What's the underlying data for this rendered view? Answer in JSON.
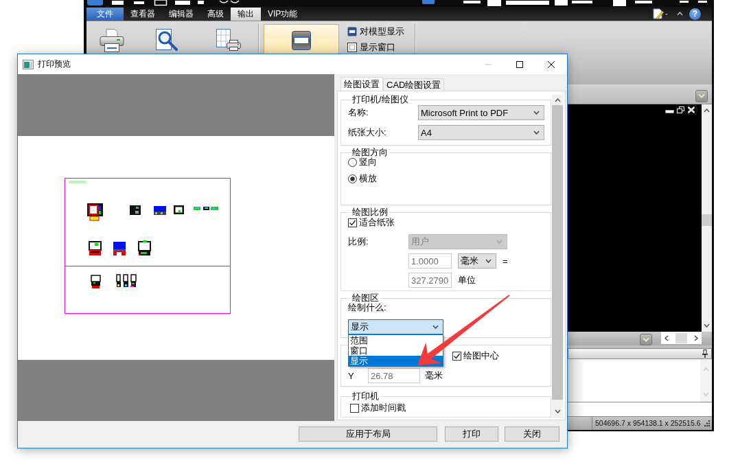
{
  "app": {
    "menu_tabs": [
      {
        "label": "文件",
        "kind": "menu",
        "selected": false
      },
      {
        "label": "查看器",
        "kind": "tab",
        "selected": false
      },
      {
        "label": "编辑器",
        "kind": "tab",
        "selected": false
      },
      {
        "label": "高级",
        "kind": "tab",
        "selected": false
      },
      {
        "label": "输出",
        "kind": "tab",
        "selected": true
      },
      {
        "label": "VIP功能",
        "kind": "tab",
        "selected": false
      }
    ],
    "help_label": "?",
    "ribbon": {
      "tools": [
        {
          "kind": "print"
        },
        {
          "kind": "preview"
        },
        {
          "kind": "layout"
        }
      ],
      "view_button": {
        "selected": true
      },
      "options": [
        {
          "label": "对模型显示",
          "kind": "model"
        },
        {
          "label": "显示窗口",
          "kind": "window"
        }
      ]
    },
    "status_bar": {
      "coordinates": "504696.7 x 954138.1 x 252515.6"
    }
  },
  "dialog": {
    "title": "打印预览",
    "minimize_disabled": true,
    "tabs": [
      {
        "label": "绘图设置",
        "selected": true
      },
      {
        "label": "CAD绘图设置",
        "selected": false
      }
    ],
    "groups": [
      {
        "title": "打印机/绘图仪",
        "rows": [
          {
            "kind": "select",
            "label": "名称:",
            "value": "Microsoft Print to PDF",
            "disabled": false
          },
          {
            "kind": "select",
            "label": "纸张大小:",
            "value": "A4",
            "disabled": false
          }
        ]
      },
      {
        "title": "绘图方向",
        "rows": [
          {
            "kind": "radio",
            "label": "竖向",
            "selected": false
          },
          {
            "kind": "radio",
            "label": "横放",
            "selected": true
          }
        ]
      },
      {
        "title": "绘图比例",
        "rows": [
          {
            "kind": "checkbox",
            "label": "适合纸张",
            "checked": true
          },
          {
            "kind": "select",
            "label": "比例:",
            "value": "用户",
            "disabled": true
          },
          {
            "kind": "input",
            "value": "1.0000",
            "disabled": true,
            "unit_select": "毫米",
            "suffix": "="
          },
          {
            "kind": "input",
            "value": "327.2790",
            "disabled": true,
            "unit": "单位"
          }
        ]
      },
      {
        "title": "绘图区",
        "rows": [
          {
            "kind": "text",
            "label": "绘制什么:"
          },
          {
            "kind": "combo",
            "value": "显示",
            "expanded": true,
            "options": [
              {
                "label": "范围",
                "selected": false
              },
              {
                "label": "窗口",
                "selected": false
              },
              {
                "label": "显示",
                "selected": true
              }
            ]
          }
        ]
      },
      {
        "rows": [
          {
            "kind": "checkbox",
            "label": "绘图中心",
            "checked": true
          },
          {
            "kind": "input",
            "label": "Y",
            "value": "26.78",
            "disabled": true,
            "unit": "毫米"
          }
        ]
      },
      {
        "title": "打印机",
        "rows": [
          {
            "kind": "checkbox",
            "label": "添加时间戳",
            "checked": false
          }
        ]
      }
    ],
    "buttons": [
      {
        "label": "应用于布局"
      },
      {
        "label": "打印"
      },
      {
        "label": "关闭"
      }
    ]
  }
}
